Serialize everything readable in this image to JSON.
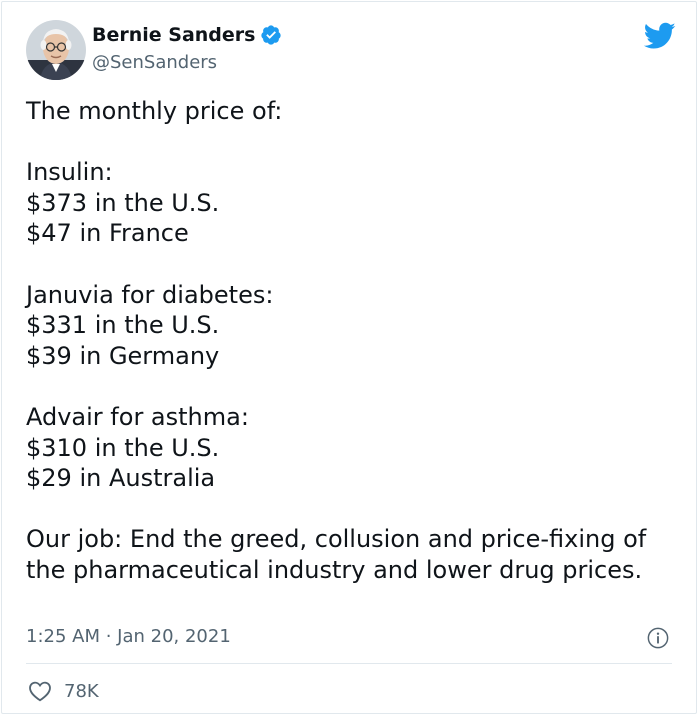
{
  "author": {
    "name": "Bernie Sanders",
    "handle": "@SenSanders",
    "verified": true
  },
  "tweet": {
    "text": "The monthly price of:\n\nInsulin:\n$373 in the U.S.\n$47 in France\n\nJanuvia for diabetes:\n$331 in the U.S.\n$39 in Germany\n\nAdvair for asthma:\n$310 in the U.S.\n$29 in Australia\n\nOur job: End the greed, collusion and price-fixing of the pharmaceutical industry and lower drug prices.",
    "timestamp": "1:25 AM · Jan 20, 2021",
    "likes": "78K"
  },
  "icons": {
    "brand": "twitter-bird-icon",
    "verified": "verified-badge-icon",
    "info": "info-icon",
    "like": "heart-icon"
  },
  "colors": {
    "twitter_blue": "#1d9bf0",
    "text_primary": "#0f1419",
    "text_secondary": "#536471",
    "border": "#e1e8ed"
  }
}
